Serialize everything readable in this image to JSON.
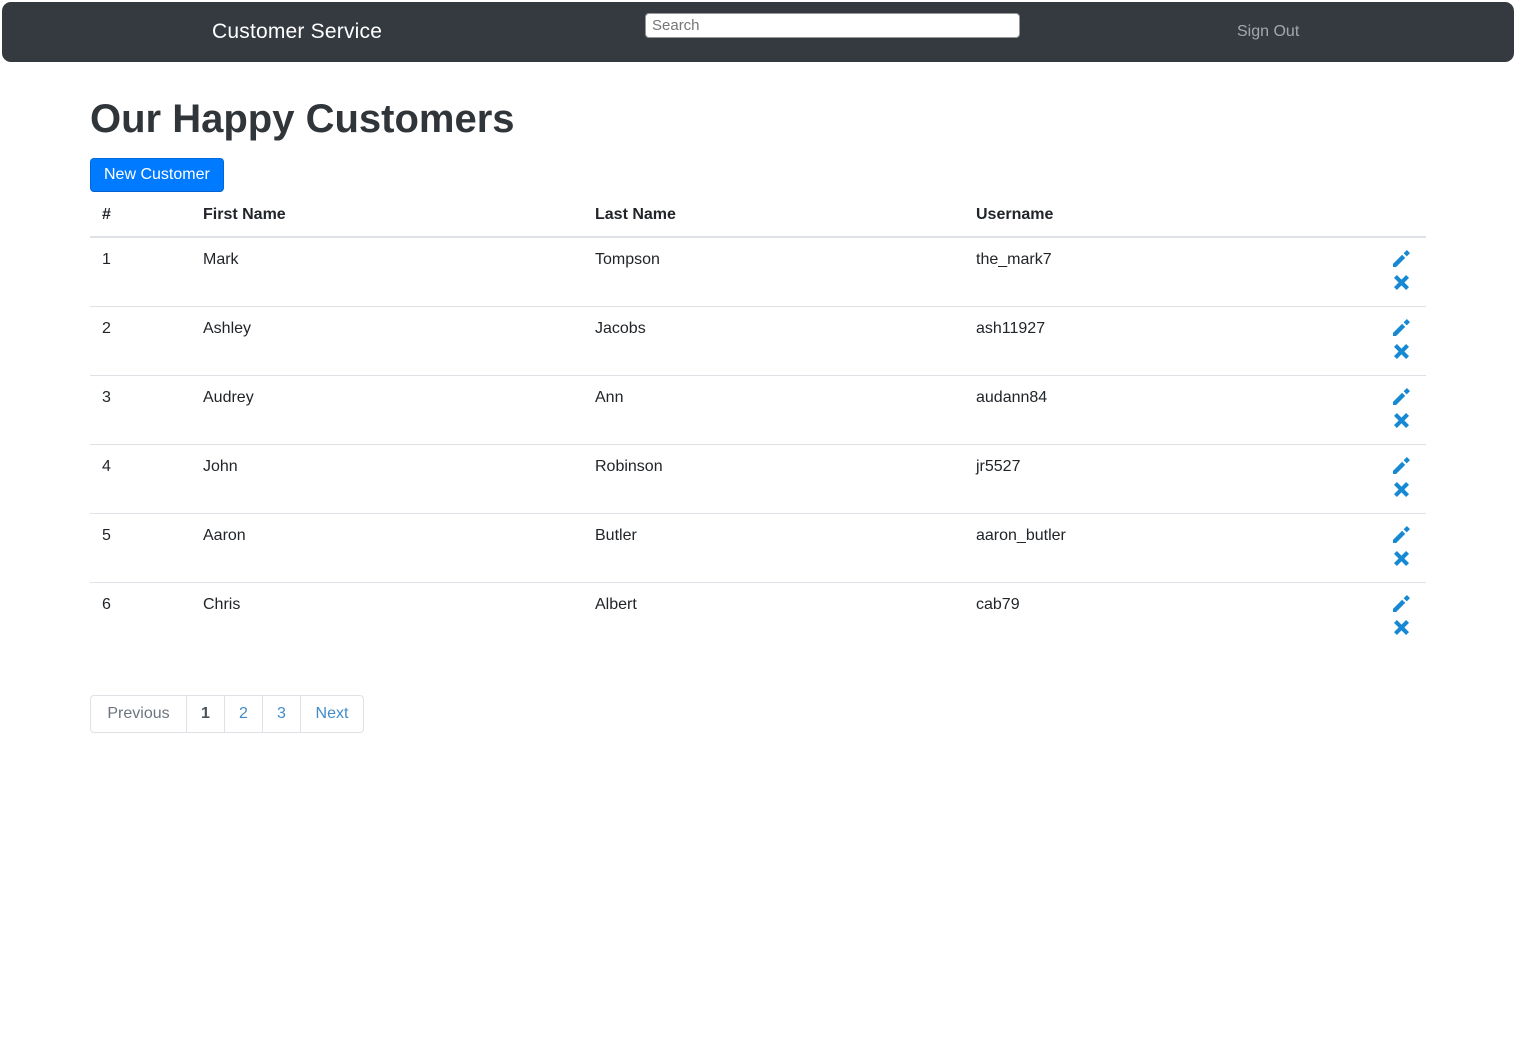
{
  "navbar": {
    "brand": "Customer Service",
    "search_placeholder": "Search",
    "sign_out": "Sign Out"
  },
  "page": {
    "title": "Our Happy Customers",
    "new_customer_button": "New Customer"
  },
  "table": {
    "headers": [
      "#",
      "First Name",
      "Last Name",
      "Username"
    ],
    "rows": [
      {
        "num": "1",
        "first": "Mark",
        "last": "Tompson",
        "username": "the_mark7"
      },
      {
        "num": "2",
        "first": "Ashley",
        "last": "Jacobs",
        "username": "ash11927"
      },
      {
        "num": "3",
        "first": "Audrey",
        "last": "Ann",
        "username": "audann84"
      },
      {
        "num": "4",
        "first": "John",
        "last": "Robinson",
        "username": "jr5527"
      },
      {
        "num": "5",
        "first": "Aaron",
        "last": "Butler",
        "username": "aaron_butler"
      },
      {
        "num": "6",
        "first": "Chris",
        "last": "Albert",
        "username": "cab79"
      }
    ],
    "row_action_icons": [
      "pencil-icon",
      "x-icon"
    ]
  },
  "pagination": {
    "previous": "Previous",
    "pages": [
      "1",
      "2",
      "3"
    ],
    "active_page": "1",
    "next": "Next"
  },
  "colors": {
    "navbar_bg": "#343a40",
    "primary": "#007bff",
    "icon_blue": "#1789d2",
    "link_blue": "#428bca",
    "border": "#dee2e6",
    "text": "#212529",
    "muted": "#6c757d"
  }
}
